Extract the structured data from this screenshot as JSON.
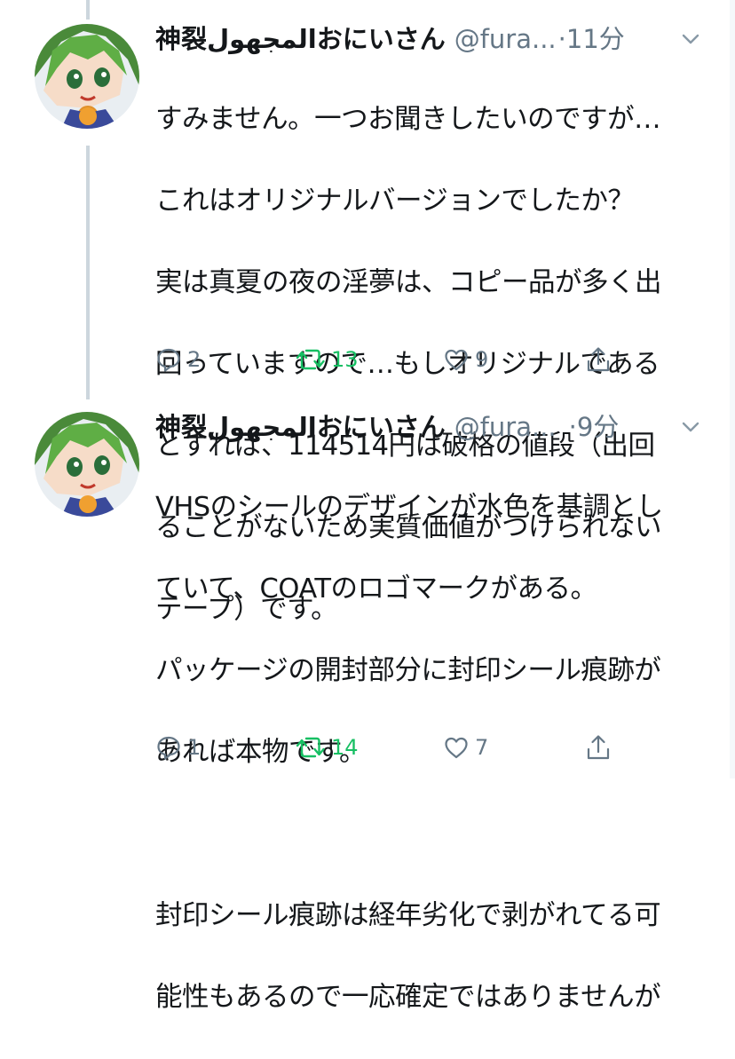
{
  "tweets": [
    {
      "display_name": "神裂المجهولおにいさん",
      "handle": "@fura...",
      "separator": "·",
      "time": "11分",
      "text": "すみません。一つお聞きしたいのですが…\nこれはオリジナルバージョンでしたか？\n実は真夏の夜の淫夢は、コピー品が多く出回っていますので…もしオリジナルであるとすれば、114514円は破格の値段（出回ることがないため実質価値がつけられないテープ）です。",
      "text_lines": [
        "すみません。一つお聞きしたいのですが…",
        "これはオリジナルバージョンでしたか？",
        "実は真夏の夜の淫夢は、コピー品が多く出",
        "回っていますので…もしオリジナルである",
        "とすれば、114514円は破格の値段（出回",
        "ることがないため実質価値がつけられない",
        "テープ）です。"
      ],
      "replies": "2",
      "retweets": "13",
      "likes": "9"
    },
    {
      "display_name": "神裂المجهولおにいさん",
      "handle": "@fura...",
      "separator": "·",
      "time": "9分",
      "text_lines": [
        "VHSのシールのデザインが水色を基調とし",
        "ていて、COATのロゴマークがある。",
        "パッケージの開封部分に封印シール痕跡が",
        "あれば本物です。",
        "",
        "封印シール痕跡は経年劣化で剥がれてる可",
        "能性もあるので一応確定ではありませんが"
      ],
      "replies": "1",
      "retweets": "14",
      "likes": "7"
    }
  ],
  "colors": {
    "text": "#14171a",
    "secondary": "#657786",
    "retweet_green": "#17bf63",
    "thread_line": "#ccd6dd"
  },
  "icons": {
    "reply": "reply-icon",
    "retweet": "retweet-icon",
    "like": "heart-icon",
    "share": "share-icon",
    "menu": "chevron-down-icon"
  }
}
